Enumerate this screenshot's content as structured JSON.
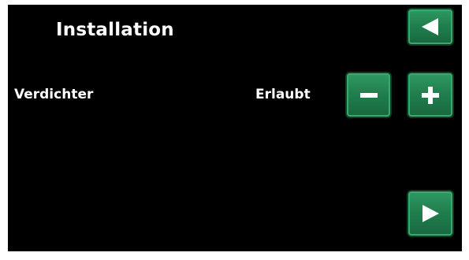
{
  "header": {
    "title": "Installation"
  },
  "setting": {
    "label": "Verdichter",
    "value": "Erlaubt"
  },
  "icons": {
    "back": "arrow-left-icon",
    "minus": "minus-icon",
    "plus": "plus-icon",
    "next": "arrow-right-icon"
  },
  "colors": {
    "background": "#000000",
    "text": "#ffffff",
    "button": "#217f4e",
    "button_highlight": "#3aa86f"
  }
}
